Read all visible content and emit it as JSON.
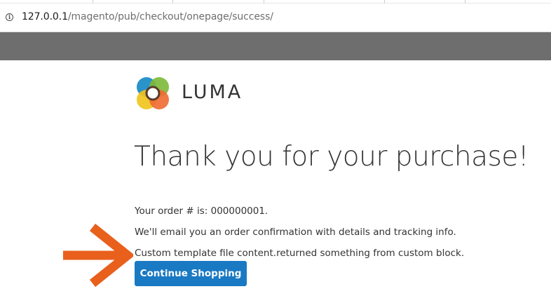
{
  "browser": {
    "url_host": "127.0.0.1",
    "url_path": "/magento/pub/checkout/onepage/success/",
    "info_icon": "info-icon"
  },
  "header": {
    "logo_text": "LUMA",
    "logo_icon": "luma-logo-icon"
  },
  "main": {
    "title": "Thank you for your purchase!",
    "order_line": "Your order # is: 000000001.",
    "email_line": "We'll email you an order confirmation with details and tracking info.",
    "custom_line": "Custom template file content.returned something from custom block.",
    "continue_label": "Continue Shopping"
  },
  "annotation": {
    "arrow_icon": "arrow-right-icon",
    "arrow_color": "#e8601c"
  },
  "colors": {
    "button": "#1979c3",
    "header_bar": "#6e6e6e",
    "text": "#333333"
  }
}
